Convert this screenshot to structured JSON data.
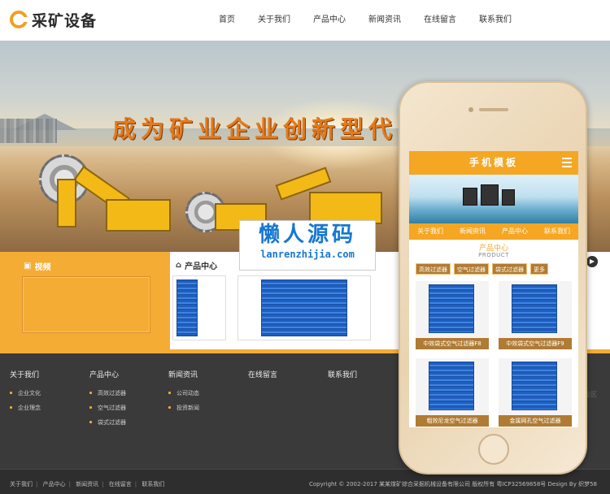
{
  "header": {
    "logo_text": "采矿设备",
    "nav": [
      "首页",
      "关于我们",
      "产品中心",
      "新闻资讯",
      "在线留言",
      "联系我们"
    ]
  },
  "banner": {
    "slogan": "成为矿业企业创新型代"
  },
  "video_section": {
    "title": "视频"
  },
  "products_section": {
    "title": "产品中心"
  },
  "watermark": {
    "main": "懒人源码",
    "sub": "lanrenzhijia.com"
  },
  "footer": {
    "columns": [
      {
        "title": "关于我们",
        "items": [
          "企业文化",
          "企业理念"
        ]
      },
      {
        "title": "产品中心",
        "items": [
          "高效过滤器",
          "空气过滤器",
          "袋式过滤器"
        ]
      },
      {
        "title": "新闻资讯",
        "items": [
          "公司动态",
          "投资新闻"
        ]
      },
      {
        "title": "在线留言",
        "items": []
      },
      {
        "title": "联系我们",
        "items": []
      }
    ],
    "bottom_links": [
      "关于我们",
      "产品中心",
      "新闻资讯",
      "在线留言",
      "联系我们"
    ],
    "copyright": "Copyright © 2002-2017 某某煤矿综合采掘机械设备有限公司 版权所有 粤ICP32569858号 Design By 织梦58",
    "faint": "业区"
  },
  "mobile": {
    "title": "手机模板",
    "nav": [
      "关于我们",
      "新闻资讯",
      "产品中心",
      "联系我们"
    ],
    "section_title": "产品中心",
    "section_sub": "PRODUCT",
    "tabs": [
      "高效过滤器",
      "空气过滤器",
      "袋式过滤器",
      "更多"
    ],
    "cards": [
      "中效袋式空气过滤器F8",
      "中效袋式空气过滤器F9",
      "粗效尼龙空气过滤器",
      "金属网孔空气过滤器"
    ]
  },
  "colors": {
    "accent": "#f5a623",
    "footer_bg": "#3a3a3a",
    "watermark_blue": "#1677d2"
  },
  "icons": [
    "logo-c-icon",
    "video-icon",
    "home-icon",
    "menu-icon",
    "next-arrow-icon"
  ]
}
